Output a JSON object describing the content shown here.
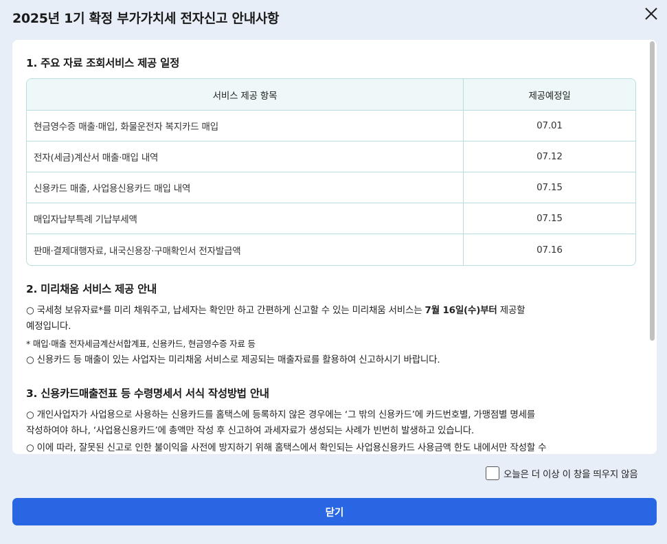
{
  "dialog": {
    "title": "2025년 1기 확정 부가가치세 전자신고 안내사항"
  },
  "section1": {
    "title": "1. 주요 자료 조회서비스 제공 일정",
    "table": {
      "headers": [
        "서비스 제공 항목",
        "제공예정일"
      ],
      "rows": [
        [
          "현금영수증 매출·매입, 화물운전자 복지카드 매입",
          "07.01"
        ],
        [
          "전자(세금)계산서 매출·매입 내역",
          "07.12"
        ],
        [
          "신용카드 매출, 사업용신용카드 매입 내역",
          "07.15"
        ],
        [
          "매입자납부특례 기납부세액",
          "07.15"
        ],
        [
          "판매·결제대행자료, 내국신용장·구매확인서 전자발급액",
          "07.16"
        ]
      ]
    }
  },
  "section2": {
    "title": "2. 미리채움 서비스 제공 안내",
    "p1_pre": "○ 국세청 보유자료*를 미리 채워주고, 납세자는 확인만 하고 간편하게 신고할 수 있는 미리채움 서비스는 ",
    "p1_bold": "7월 16일(수)부터",
    "p1_post": " 제공할",
    "p1_line2": "예정입니다.",
    "note": "* 매입·매출 전자세금계산서합계표, 신용카드, 현금영수증 자료 등",
    "p2": "○ 신용카드 등 매출이 있는 사업자는 미리채움 서비스로 제공되는 매출자료를 활용하여 신고하시기 바랍니다."
  },
  "section3": {
    "title": "3. 신용카드매출전표 등 수령명세서 서식 작성방법 안내",
    "p1_line1": "○ 개인사업자가 사업용으로 사용하는 신용카드를 홈택스에 등록하지 않은 경우에는 ‘그 밖의 신용카드’에 카드번호별, 가맹점별 명세를",
    "p1_line2": "작성하여야 하나, ‘사업용신용카드’에 총액만 작성 후 신고하여 과세자료가 생성되는 사례가 빈번히 발생하고 있습니다.",
    "p2_line1": "○ 이에 따라, 잘못된 신고로 인한 불이익을 사전에 방지하기 위해 홈택스에서 확인되는  사업용신용카드 사용금액 한도 내에서만 작성할 수"
  },
  "footer": {
    "dont_show_label": "오늘은 더 이상 이 창을 띄우지 않음",
    "dont_show_checked": false,
    "close_label": "닫기"
  },
  "colors": {
    "accent": "#2866e4",
    "table_border": "#b7dde0",
    "table_header_bg": "#eef8f8",
    "page_bg": "#e8eef8"
  }
}
